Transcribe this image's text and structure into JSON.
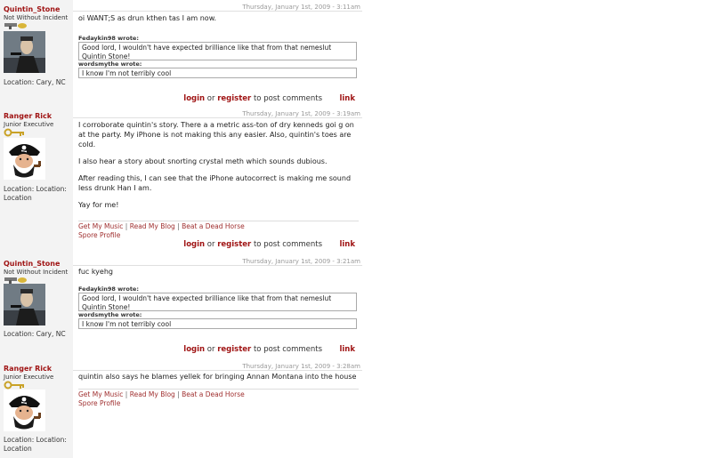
{
  "posts": [
    {
      "username": "Quintin_Stone",
      "rank": "Not Without Incident",
      "location": "Location: Cary, NC",
      "date": "Thursday, January 1st, 2009 - 3:11am",
      "body": [
        "oi WANT;S as drun kthen tas I am now."
      ],
      "quotes": [
        {
          "author": "Fedaykin98 wrote:",
          "text": "Good lord, I wouldn't have expected brilliance like that from that nemeslut Quintin Stone!"
        },
        {
          "author": "wordsmythe wrote:",
          "text": "I know I'm not terribly cool"
        }
      ],
      "actions": {
        "login": "login",
        "or": "or",
        "register": "register",
        "rest": "to post comments",
        "link": "link"
      }
    },
    {
      "username": "Ranger Rick",
      "rank": "Junior Executive",
      "location": "Location: Location: Location",
      "date": "Thursday, January 1st, 2009 - 3:19am",
      "body": [
        "I corroborate quintin's story. There a a metric ass-ton of dry kenneds goi g on at the party. My iPhone is not making this any easier. Also, quintin's toes are cold.",
        "I also hear a story about snorting crystal meth which sounds dubious.",
        "After reading this, I can see that the iPhone autocorrect is making me sound less drunk Han I am.",
        "Yay for me!"
      ],
      "signature": {
        "music": "Get My Music",
        "blog": "Read My Blog",
        "horse": "Beat a Dead Horse",
        "spore": "Spore Profile",
        "sep": "|"
      },
      "actions": {
        "login": "login",
        "or": "or",
        "register": "register",
        "rest": "to post comments",
        "link": "link"
      }
    },
    {
      "username": "Quintin_Stone",
      "rank": "Not Without Incident",
      "location": "Location: Cary, NC",
      "date": "Thursday, January 1st, 2009 - 3:21am",
      "body": [
        "fuc kyehg"
      ],
      "quotes": [
        {
          "author": "Fedaykin98 wrote:",
          "text": "Good lord, I wouldn't have expected brilliance like that from that nemeslut Quintin Stone!"
        },
        {
          "author": "wordsmythe wrote:",
          "text": "I know I'm not terribly cool"
        }
      ],
      "actions": {
        "login": "login",
        "or": "or",
        "register": "register",
        "rest": "to post comments",
        "link": "link"
      }
    },
    {
      "username": "Ranger Rick",
      "rank": "Junior Executive",
      "location": "Location: Location: Location",
      "date": "Thursday, January 1st, 2009 - 3:28am",
      "body": [
        "quintin also says he blames yellek for bringing Annan Montana into the house"
      ],
      "signature": {
        "music": "Get My Music",
        "blog": "Read My Blog",
        "horse": "Beat a Dead Horse",
        "spore": "Spore Profile",
        "sep": "|"
      }
    }
  ]
}
